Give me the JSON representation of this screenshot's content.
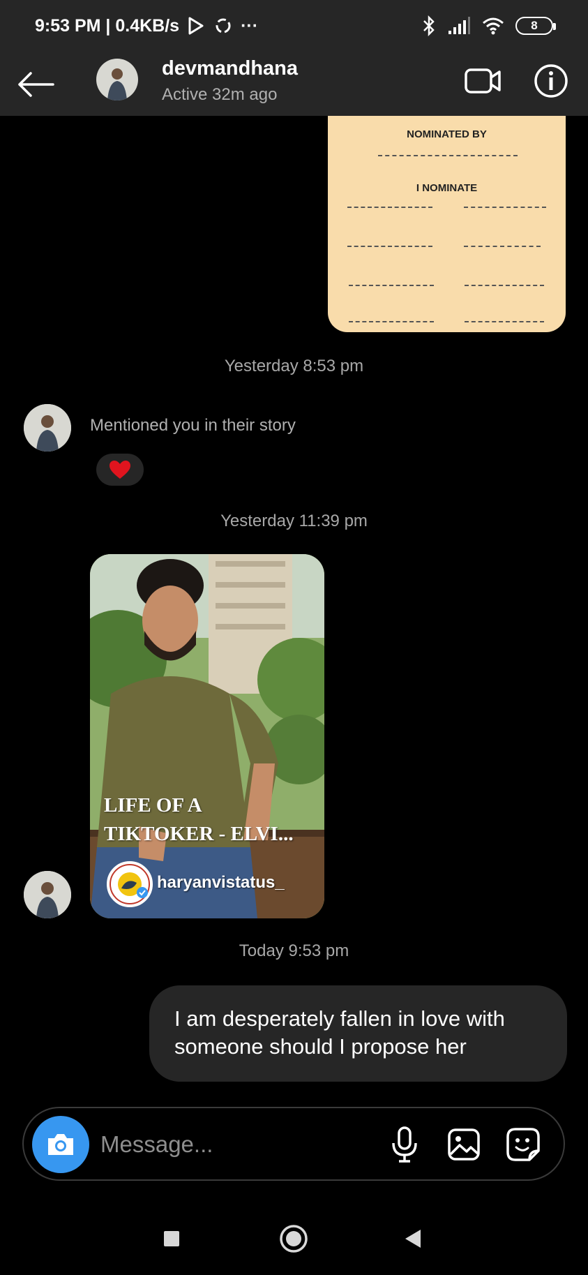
{
  "status_bar": {
    "time_speed": "9:53 PM | 0.4KB/s",
    "more": "···",
    "battery": "8"
  },
  "header": {
    "username": "devmandhana",
    "activity": "Active 32m ago"
  },
  "shared_card": {
    "nominated_by": "NOMINATED BY",
    "i_nominate": "I NOMINATE"
  },
  "messages": {
    "timestamp_1": "Yesterday 8:53 pm",
    "mention": "Mentioned you in their story",
    "reaction": "❤️",
    "timestamp_2": "Yesterday 11:39 pm",
    "story_caption_line1": "LIFE OF A",
    "story_caption_line2": "TIKTOKER - ELVI...",
    "story_handle": "haryanvistatus_",
    "timestamp_3": "Today 9:53 pm",
    "outgoing_text": "I am desperately fallen in love with someone should I propose her"
  },
  "composer": {
    "placeholder": "Message..."
  },
  "colors": {
    "accent": "#3797f0",
    "bubble": "#262626",
    "card": "#f9dcab"
  }
}
